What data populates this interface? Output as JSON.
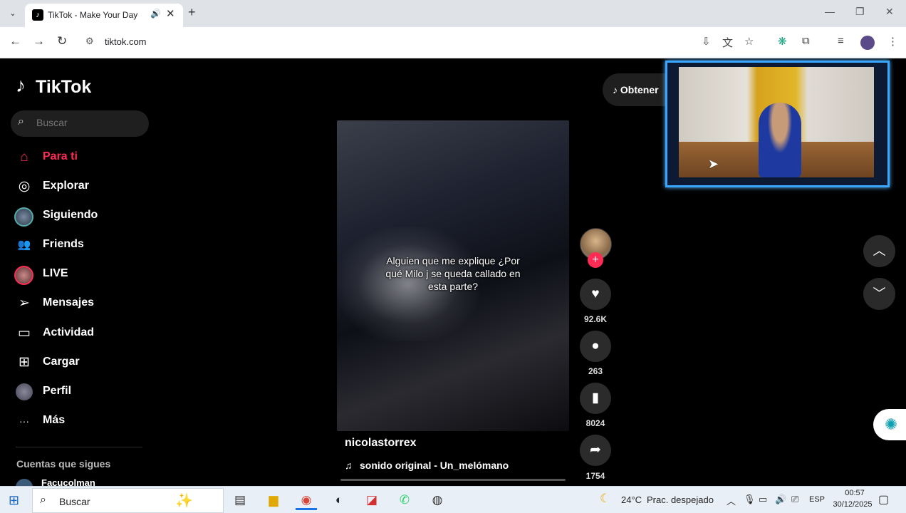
{
  "browser": {
    "tab_title": "TikTok - Make Your Day",
    "tab_favicon": "♪",
    "url": "tiktok.com",
    "window_controls": [
      "—",
      "❐",
      "✕"
    ]
  },
  "tiktok": {
    "logo": "TikTok",
    "search_placeholder": "Buscar",
    "nav": [
      {
        "label": "Para ti",
        "icon": "home-icon",
        "glyph": "⌂"
      },
      {
        "label": "Explorar",
        "icon": "compass-icon",
        "glyph": "◎"
      },
      {
        "label": "Siguiendo",
        "icon": "following-avatar-icon",
        "glyph": ""
      },
      {
        "label": "Friends",
        "icon": "friends-icon",
        "glyph": "👥"
      },
      {
        "label": "LIVE",
        "icon": "live-avatar-icon",
        "glyph": ""
      },
      {
        "label": "Mensajes",
        "icon": "send-icon",
        "glyph": "➢"
      },
      {
        "label": "Actividad",
        "icon": "activity-icon",
        "glyph": "▭"
      },
      {
        "label": "Cargar",
        "icon": "upload-icon",
        "glyph": "⊞"
      },
      {
        "label": "Perfil",
        "icon": "profile-avatar-icon",
        "glyph": ""
      },
      {
        "label": "Más",
        "icon": "more-icon",
        "glyph": "···"
      }
    ],
    "following_title": "Cuentas que sigues",
    "following_users": [
      "Facucolman"
    ],
    "get_app_label": "Obtener",
    "video": {
      "caption": "Alguien que me explique ¿Por qué Milo j se queda callado en esta parte?",
      "author": "nicolastorrex",
      "sound": "sonido original - Un_melómano",
      "likes": "92.6K",
      "comments": "263",
      "saves": "8024",
      "shares": "1754"
    }
  },
  "taskbar": {
    "search_label": "Buscar",
    "temperature": "24°C",
    "weather": "Prac. despejado",
    "language": "ESP",
    "time": "00:57",
    "date": "30/12/2025"
  }
}
